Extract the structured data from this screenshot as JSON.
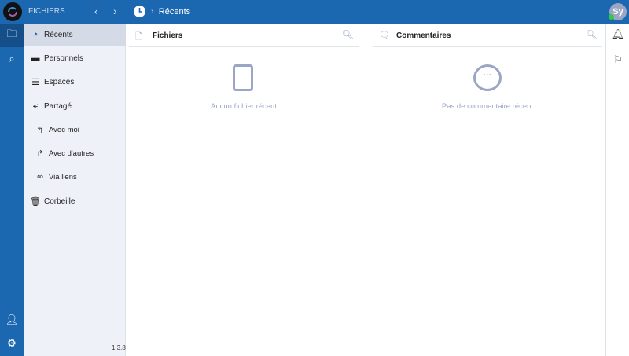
{
  "header": {
    "app_title": "FICHIERS",
    "breadcrumb": "Récents",
    "avatar_initials": "Sy",
    "status_color": "#2ecc40"
  },
  "sidebar": {
    "items": [
      {
        "label": "Récents",
        "icon": "clock-icon"
      },
      {
        "label": "Personnels",
        "icon": "folder-icon"
      },
      {
        "label": "Espaces",
        "icon": "layers-icon"
      },
      {
        "label": "Partagé",
        "icon": "share-icon"
      },
      {
        "label": "Avec moi",
        "icon": "reply-icon"
      },
      {
        "label": "Avec d'autres",
        "icon": "forward-icon"
      },
      {
        "label": "Via liens",
        "icon": "link-icon"
      },
      {
        "label": "Corbeille",
        "icon": "trash-icon"
      }
    ],
    "version": "1.3.8"
  },
  "files_panel": {
    "title": "Fichiers",
    "empty": "Aucun fichier récent"
  },
  "comments_panel": {
    "title": "Commentaires",
    "empty": "Pas de commentaire récent"
  },
  "colors": {
    "brand": "#1b67b0",
    "muted": "#9aa6c4"
  }
}
